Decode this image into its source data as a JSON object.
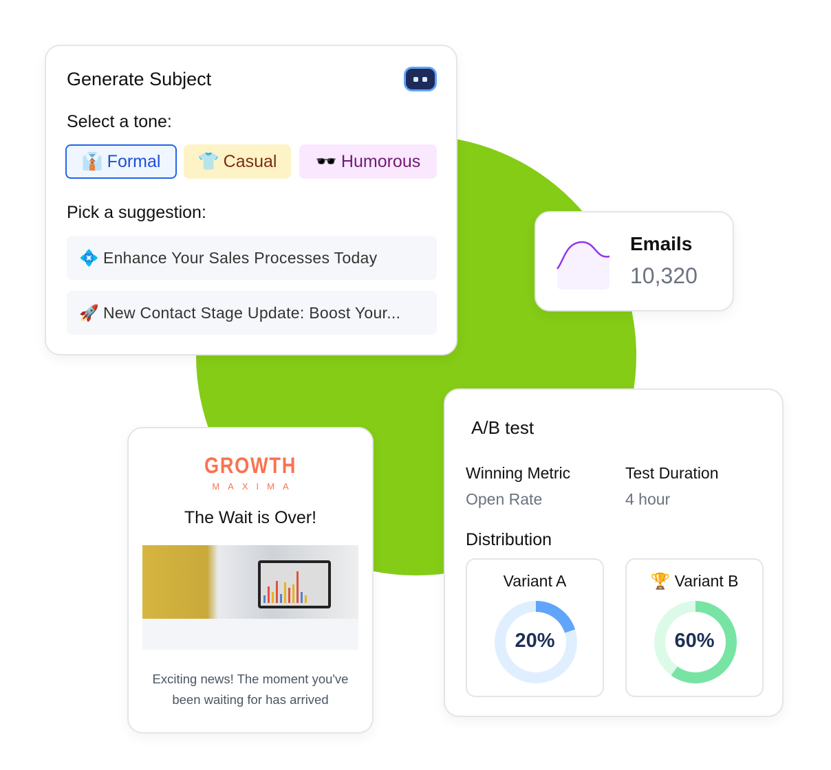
{
  "generate": {
    "title": "Generate Subject",
    "tone_label": "Select a tone:",
    "tones": [
      {
        "emoji": "👔",
        "label": "Formal",
        "selected": true
      },
      {
        "emoji": "👕",
        "label": "Casual",
        "selected": false
      },
      {
        "emoji": "🕶️",
        "label": "Humorous",
        "selected": false
      }
    ],
    "suggestion_label": "Pick a suggestion:",
    "suggestions": [
      {
        "emoji": "💠",
        "text": "Enhance Your Sales Processes Today"
      },
      {
        "emoji": "🚀",
        "text": "New Contact Stage Update: Boost Your..."
      }
    ]
  },
  "emails": {
    "label": "Emails",
    "value": "10,320",
    "accent": "#9333ea"
  },
  "newsletter": {
    "logo_main": "GROWTH",
    "logo_sub": "MAXIMA",
    "heading": "The Wait is Over!",
    "body": "Exciting news! The moment you've been waiting for has arrived"
  },
  "ab_test": {
    "title": "A/B test",
    "winning_metric_label": "Winning Metric",
    "winning_metric_value": "Open Rate",
    "duration_label": "Test Duration",
    "duration_value": "4 hour",
    "distribution_label": "Distribution",
    "variants": [
      {
        "name": "Variant A",
        "trophy": "",
        "percent": 20,
        "percent_label": "20%",
        "color": "#60a5fa",
        "track": "#e0efff"
      },
      {
        "name": "Variant B",
        "trophy": "🏆",
        "percent": 60,
        "percent_label": "60%",
        "color": "#77e4a3",
        "track": "#dcfae8"
      }
    ]
  },
  "colors": {
    "background_blob": "#84cc16",
    "brand": "#f97350"
  }
}
